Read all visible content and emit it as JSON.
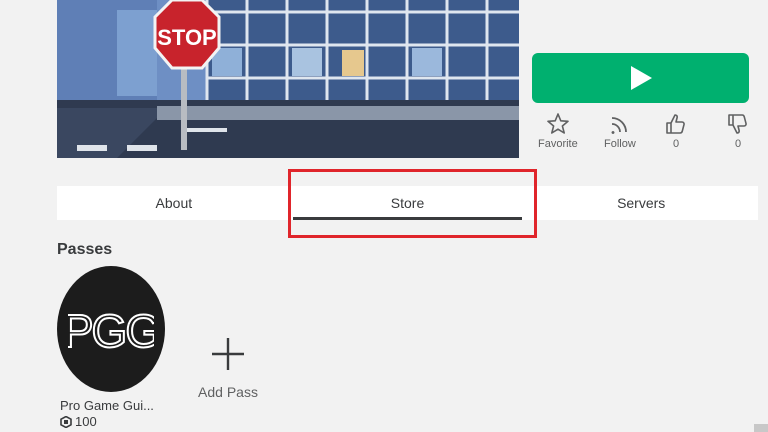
{
  "game": {
    "thumbnail_icon": "game-thumbnail-image",
    "sign_text": "STOP",
    "play_icon": "play-icon"
  },
  "actions": {
    "favorite": {
      "label": "Favorite",
      "icon": "star-icon"
    },
    "follow": {
      "label": "Follow",
      "icon": "follow-icon"
    },
    "upvote": {
      "count": "0",
      "icon": "thumbs-up-icon"
    },
    "downvote": {
      "count": "0",
      "icon": "thumbs-down-icon"
    }
  },
  "tabs": [
    {
      "label": "About"
    },
    {
      "label": "Store",
      "active": true
    },
    {
      "label": "Servers"
    }
  ],
  "store": {
    "section_title": "Passes",
    "passes": [
      {
        "name": "Pro Game Gui...",
        "price": "100",
        "logo_text": "PGG"
      }
    ],
    "add_pass_label": "Add Pass"
  },
  "colors": {
    "play": "#00b06f",
    "highlight": "#e0252b",
    "background": "#f2f2f2"
  }
}
